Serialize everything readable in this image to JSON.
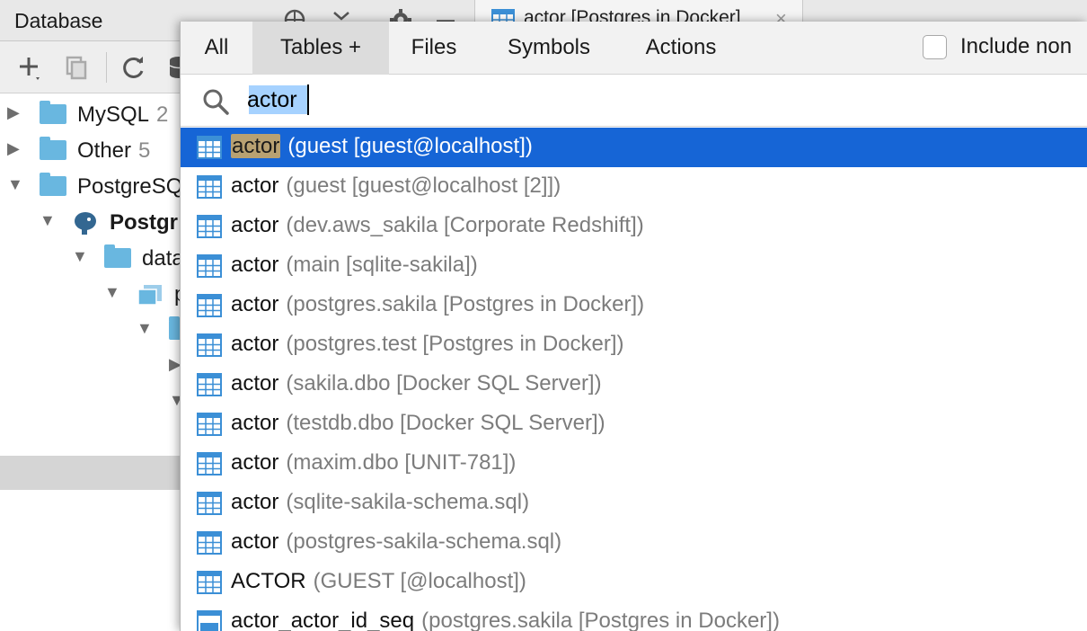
{
  "tool_window": {
    "title": "Database",
    "header_icons": [
      "globe-icon",
      "collapse-icon",
      "gear-icon",
      "minimize-icon"
    ],
    "toolbar_icons": [
      "add-icon",
      "copy-icon",
      "refresh-icon",
      "database-icon"
    ]
  },
  "editor_tab": {
    "label": "actor [Postgres in Docker]",
    "close": "×"
  },
  "tree": {
    "items": [
      {
        "label": "MySQL",
        "count": "2"
      },
      {
        "label": "Other",
        "count": "5"
      },
      {
        "label": "PostgreSQ",
        "count": ""
      },
      {
        "label": "Postgr",
        "count": ""
      },
      {
        "label": "data",
        "count": ""
      },
      {
        "label": "p",
        "count": ""
      }
    ]
  },
  "popup": {
    "tabs": [
      {
        "label": "All"
      },
      {
        "label": "Tables +"
      },
      {
        "label": "Files"
      },
      {
        "label": "Symbols"
      },
      {
        "label": "Actions"
      }
    ],
    "active_tab": "Tables +",
    "include_label": "Include non",
    "search": {
      "value": "actor",
      "placeholder": ""
    },
    "results": [
      {
        "name": "actor",
        "location": "(guest [guest@localhost])",
        "icon": "table-icon"
      },
      {
        "name": "actor",
        "location": "(guest [guest@localhost [2]])",
        "icon": "table-icon"
      },
      {
        "name": "actor",
        "location": "(dev.aws_sakila [Corporate Redshift])",
        "icon": "table-icon"
      },
      {
        "name": "actor",
        "location": "(main [sqlite-sakila])",
        "icon": "table-icon"
      },
      {
        "name": "actor",
        "location": "(postgres.sakila [Postgres in Docker])",
        "icon": "table-icon"
      },
      {
        "name": "actor",
        "location": "(postgres.test [Postgres in Docker])",
        "icon": "table-icon"
      },
      {
        "name": "actor",
        "location": "(sakila.dbo [Docker SQL Server])",
        "icon": "table-icon"
      },
      {
        "name": "actor",
        "location": "(testdb.dbo [Docker SQL Server])",
        "icon": "table-icon"
      },
      {
        "name": "actor",
        "location": "(maxim.dbo [UNIT-781])",
        "icon": "table-icon"
      },
      {
        "name": "actor",
        "location": "(sqlite-sakila-schema.sql)",
        "icon": "table-icon"
      },
      {
        "name": "actor",
        "location": "(postgres-sakila-schema.sql)",
        "icon": "table-icon"
      },
      {
        "name": "ACTOR",
        "location": "(GUEST [@localhost])",
        "icon": "table-icon"
      },
      {
        "name": "actor_actor_id_seq",
        "location": "(postgres.sakila [Postgres in Docker])",
        "icon": "sequence-icon"
      }
    ]
  },
  "colors": {
    "selection": "#1665d6",
    "match_highlight": "#b8a172",
    "folder": "#69b7e0",
    "table_icon": "#3b8fd6"
  }
}
